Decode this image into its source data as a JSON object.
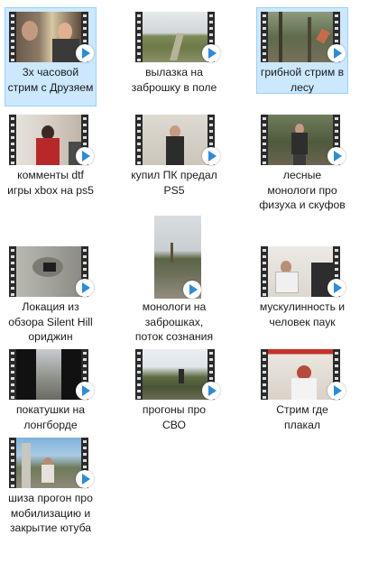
{
  "files": [
    {
      "label": "3х часовой стрим с Друзяем",
      "selected": true,
      "icon": "video-thumbnail"
    },
    {
      "label": "вылазка на заброшку в поле",
      "selected": false,
      "icon": "video-thumbnail"
    },
    {
      "label": "грибной стрим в лесу",
      "selected": true,
      "icon": "video-thumbnail"
    },
    {
      "label": "комменты dtf игры xbox на ps5",
      "selected": false,
      "icon": "video-thumbnail"
    },
    {
      "label": "купил ПК предал PS5",
      "selected": false,
      "icon": "video-thumbnail"
    },
    {
      "label": "лесные монологи про физуха и скуфов",
      "selected": false,
      "icon": "video-thumbnail"
    },
    {
      "label": "Локация из обзора Silent Hill ориджин",
      "selected": false,
      "icon": "video-thumbnail"
    },
    {
      "label": "монологи на заброшках, поток сознания",
      "selected": false,
      "icon": "video-thumbnail"
    },
    {
      "label": "мускулинность и человек паук",
      "selected": false,
      "icon": "video-thumbnail"
    },
    {
      "label": "покатушки на лонгборде",
      "selected": false,
      "icon": "video-thumbnail"
    },
    {
      "label": "прогоны про СВО",
      "selected": false,
      "icon": "video-thumbnail"
    },
    {
      "label": "Стрим где плакал",
      "selected": false,
      "icon": "video-thumbnail"
    },
    {
      "label": "шиза прогон про мобилизацию и закрытие ютуба",
      "selected": false,
      "icon": "video-thumbnail"
    }
  ],
  "colors": {
    "selection_bg": "#cce8ff",
    "selection_border": "#99d1ff",
    "play_arrow": "#2a8cdb"
  }
}
